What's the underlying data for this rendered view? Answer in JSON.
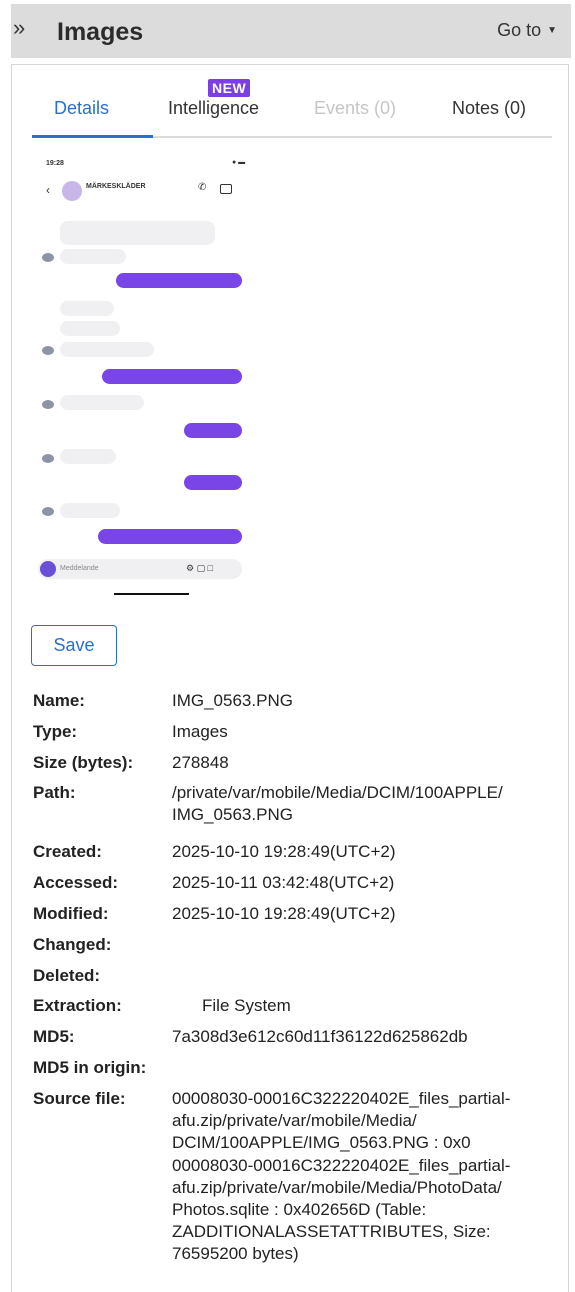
{
  "header": {
    "title": "Images",
    "goto_label": "Go to"
  },
  "tabs": [
    {
      "label": "Details",
      "active": true
    },
    {
      "label": "Intelligence",
      "badge": "NEW"
    },
    {
      "label": "Events (0)",
      "disabled": true
    },
    {
      "label": "Notes (0)"
    }
  ],
  "thumbnail": {
    "time": "19:28",
    "contact": "MÄRKESKLÄDER",
    "input_placeholder": "Meddelande"
  },
  "save_label": "Save",
  "properties": [
    {
      "key": "Name:",
      "value": "IMG_0563.PNG"
    },
    {
      "key": "Type:",
      "value": "Images"
    },
    {
      "key": "Size (bytes):",
      "value": "278848"
    },
    {
      "key": "Path:",
      "value": "/private/var/mobile/Media/DCIM/100APPLE/\nIMG_0563.PNG"
    },
    {
      "key": "Created:",
      "value": "2025-10-10 19:28:49(UTC+2)"
    },
    {
      "key": "Accessed:",
      "value": "2025-10-11 03:42:48(UTC+2)"
    },
    {
      "key": "Modified:",
      "value": "2025-10-10 19:28:49(UTC+2)"
    },
    {
      "key": "Changed:",
      "value": ""
    },
    {
      "key": "Deleted:",
      "value": ""
    },
    {
      "key": "Extraction:",
      "value": "File System"
    },
    {
      "key": "MD5:",
      "value": "7a308d3e612c60d11f36122d625862db"
    },
    {
      "key": "MD5 in origin:",
      "value": ""
    },
    {
      "key": "Source file:",
      "value": "00008030-00016C322220402E_files_partial-\nafu.zip/private/var/mobile/Media/\nDCIM/100APPLE/IMG_0563.PNG : 0x0"
    },
    {
      "key": "",
      "value": "00008030-00016C322220402E_files_partial-\nafu.zip/private/var/mobile/Media/PhotoData/\nPhotos.sqlite : 0x402656D (Table:\nZADDITIONALASSETATTRIBUTES, Size:\n76595200 bytes)"
    }
  ],
  "colors": {
    "accent": "#2a6fd0",
    "badge": "#7b3fe4",
    "outgoing_bubble": "#7a45e6"
  }
}
